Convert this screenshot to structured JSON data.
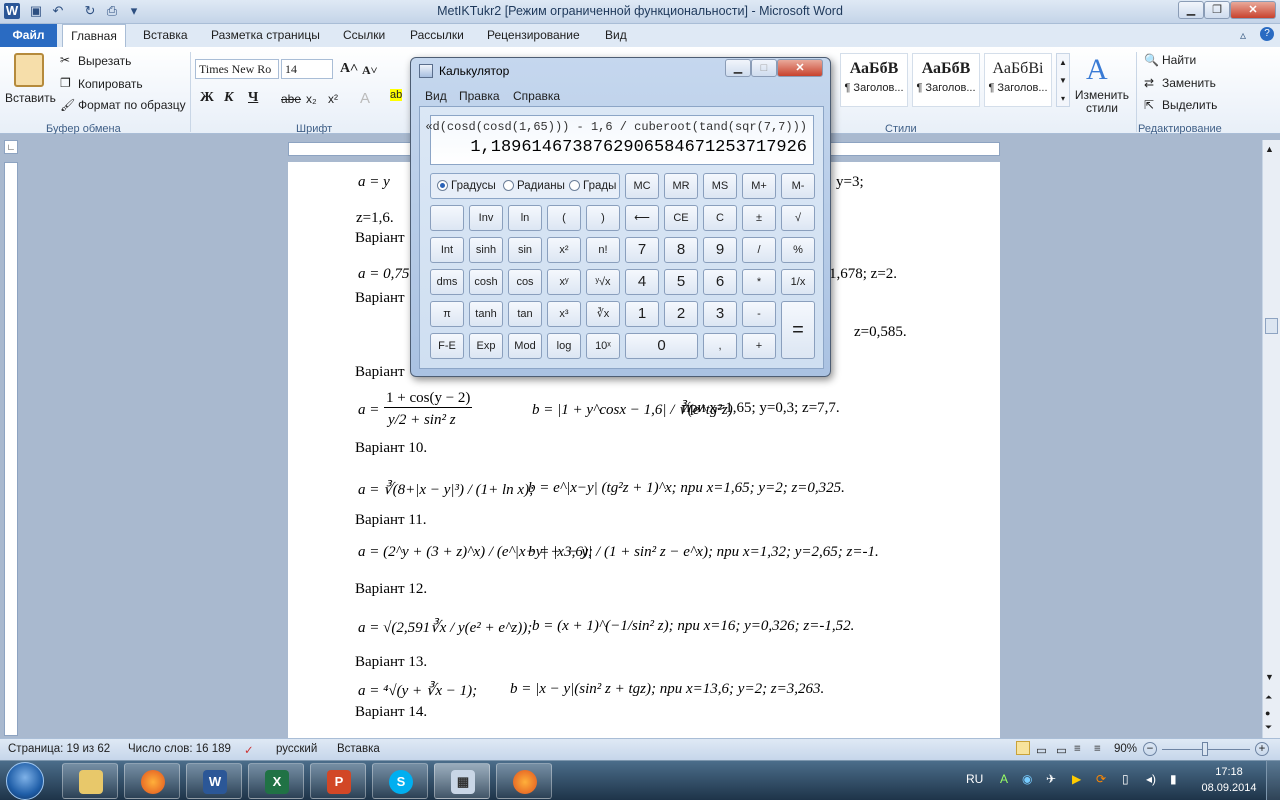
{
  "window": {
    "title": "MetIKTukr2 [Режим ограниченной функциональности] - Microsoft Word"
  },
  "ribbon": {
    "tabs": [
      "Файл",
      "Главная",
      "Вставка",
      "Разметка страницы",
      "Ссылки",
      "Рассылки",
      "Рецензирование",
      "Вид"
    ],
    "clipboard": {
      "paste": "Вставить",
      "cut": "Вырезать",
      "copy": "Копировать",
      "format_painter": "Формат по образцу",
      "group": "Буфер обмена"
    },
    "font": {
      "name": "Times New Ro",
      "size": "14",
      "group": "Шрифт"
    },
    "styles": {
      "items": [
        {
          "sample": "АаБбВ",
          "label": "¶ Заголов..."
        },
        {
          "sample": "АаБбВ",
          "label": "¶ Заголов..."
        },
        {
          "sample": "АаБбВі",
          "label": "¶ Заголов..."
        }
      ],
      "change": "Изменить стили",
      "group": "Стили"
    },
    "editing": {
      "find": "Найти",
      "replace": "Заменить",
      "select": "Выделить",
      "group": "Редактирование"
    }
  },
  "document": {
    "line_a9": "a = y",
    "z16": "z=1,6.",
    "y3": "y=3;",
    "var_label": "Варіант",
    "a075": "a = 0,75",
    "z2": "-1,678;  z=2.",
    "z0585": "z=0,585.",
    "v9a": "1 + cos(y − 2)",
    "v9b": "y/2 + sin² z",
    "v9b_expr": "b = |1 + y^cosx − 1,6| / ∛(e^tg²z)",
    "v9_vals": "при   x=1,65;    y=0,3;      z=7,7.",
    "v10": "Варіант 10.",
    "v10_a": "a = ∛(8+|x − y|³) / (1+ ln x);",
    "v10_b": "b = e^|x−y| (tg²z + 1)^x; при   x=1,65;     y=2;          z=0,325.",
    "v11": "Варіант 11.",
    "v11_a": "a = (2^y + (3 + z)^x) / (e^|x−y| + 3,6);",
    "v11_b": "b = |x − y| / (1 + sin² z − e^x);    при   x=1,32;     y=2,65;      z=-1.",
    "v12": "Варіант 12.",
    "v12_a": "a = √(2,591∛x / y(e² + e^z));",
    "v12_b": "b = (x + 1)^(−1/sin² z);      при   x=16;       y=0,326;       z=-1,52.",
    "v13": "Варіант 13.",
    "v13_a": "a = ⁴√(y + ∛x − 1);",
    "v13_b": "b = |x − y|(sin² z + tgz);     при   x=13,6;      y=2;        z=3,263.",
    "v14": "Варіант 14."
  },
  "calculator": {
    "title": "Калькулятор",
    "menu": [
      "Вид",
      "Правка",
      "Справка"
    ],
    "expression": "«d(cosd(cosd(1,65))) - 1,6 / cuberoot(tand(sqr(7,7)))",
    "result": "1,1896146738762906584671253717926",
    "modes": [
      {
        "label": "Градусы",
        "selected": true
      },
      {
        "label": "Радианы",
        "selected": false
      },
      {
        "label": "Грады",
        "selected": false
      }
    ],
    "memory": [
      "MC",
      "MR",
      "MS",
      "M+",
      "M-"
    ],
    "rows": [
      [
        "",
        "Inv",
        "ln",
        "(",
        ")",
        "⟵",
        "CE",
        "C",
        "±",
        "√"
      ],
      [
        "Int",
        "sinh",
        "sin",
        "x²",
        "n!",
        "7",
        "8",
        "9",
        "/",
        "%"
      ],
      [
        "dms",
        "cosh",
        "cos",
        "xʸ",
        "ʸ√x",
        "4",
        "5",
        "6",
        "*",
        "1/x"
      ],
      [
        "π",
        "tanh",
        "tan",
        "x³",
        "∛x",
        "1",
        "2",
        "3",
        "-",
        ""
      ],
      [
        "F-E",
        "Exp",
        "Mod",
        "log",
        "10ˣ",
        "0",
        "",
        ",",
        "+",
        ""
      ]
    ],
    "equals": "="
  },
  "status": {
    "page": "Страница: 19 из 62",
    "words": "Число слов: 16 189",
    "lang": "русский",
    "mode": "Вставка",
    "zoom": "90%"
  },
  "tray": {
    "lang": "RU",
    "time": "17:18",
    "date": "08.09.2014"
  },
  "taskbar": {
    "apps": [
      "explorer",
      "firefox",
      "word",
      "excel",
      "powerpoint",
      "skype",
      "calculator",
      "firefox"
    ]
  }
}
